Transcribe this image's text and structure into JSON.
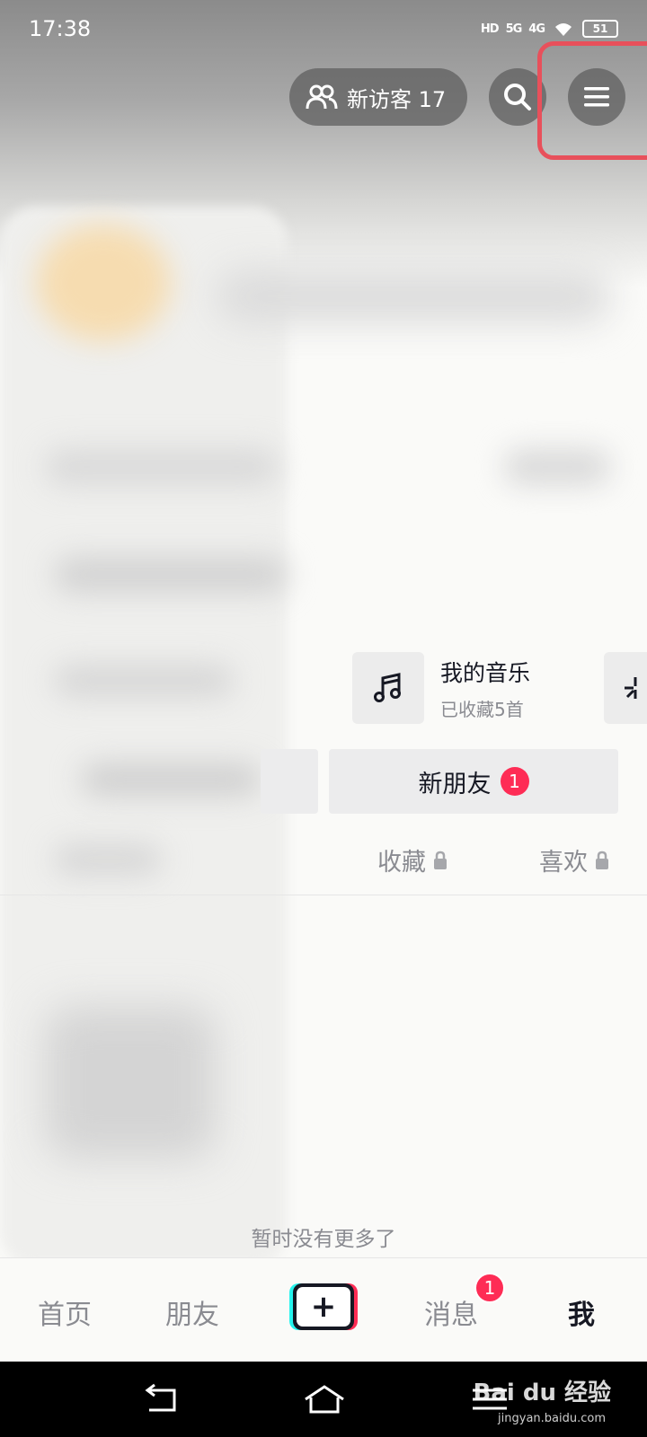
{
  "status_bar": {
    "time": "17:38",
    "network_hd": "HD",
    "network_5g": "5G",
    "network_4g": "4G",
    "battery": "51"
  },
  "header": {
    "visitor_label": "新访客 17",
    "visitor_icon": "users-icon",
    "search_icon": "search-icon",
    "menu_icon": "menu-icon",
    "highlight_color": "#e8505b"
  },
  "music_card": {
    "title": "我的音乐",
    "subtitle": "已收藏5首",
    "icon": "music-note-icon"
  },
  "friend_button": {
    "label": "新朋友",
    "badge": "1"
  },
  "profile_tabs": [
    {
      "label": "收藏",
      "locked": true
    },
    {
      "label": "喜欢",
      "locked": true
    }
  ],
  "empty_text": "暂时没有更多了",
  "tab_bar": {
    "home": "首页",
    "friends": "朋友",
    "plus_icon": "plus-icon",
    "messages": "消息",
    "messages_badge": "1",
    "me": "我"
  },
  "watermark": {
    "brand": "Bai du 经验",
    "url": "jingyan.baidu.com"
  },
  "colors": {
    "accent_red": "#fe2c55",
    "accent_cyan": "#25f4ee",
    "text_primary": "#161823",
    "text_secondary": "#8a8b91"
  }
}
